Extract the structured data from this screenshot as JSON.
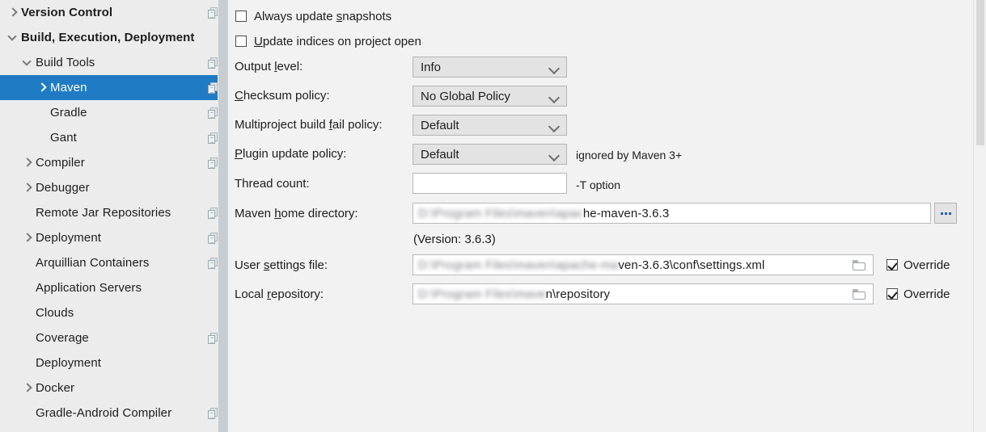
{
  "sidebar": {
    "items": [
      {
        "label": "Version Control",
        "indent": 0,
        "arrow": "collapsed",
        "bold": true,
        "copy": true,
        "selected": false
      },
      {
        "label": "Build, Execution, Deployment",
        "indent": 0,
        "arrow": "expanded",
        "bold": true,
        "copy": false,
        "selected": false
      },
      {
        "label": "Build Tools",
        "indent": 1,
        "arrow": "expanded",
        "bold": false,
        "copy": true,
        "selected": false
      },
      {
        "label": "Maven",
        "indent": 2,
        "arrow": "collapsed",
        "bold": false,
        "copy": true,
        "selected": true
      },
      {
        "label": "Gradle",
        "indent": 2,
        "arrow": "none",
        "bold": false,
        "copy": true,
        "selected": false
      },
      {
        "label": "Gant",
        "indent": 2,
        "arrow": "none",
        "bold": false,
        "copy": true,
        "selected": false
      },
      {
        "label": "Compiler",
        "indent": 1,
        "arrow": "collapsed",
        "bold": false,
        "copy": true,
        "selected": false
      },
      {
        "label": "Debugger",
        "indent": 1,
        "arrow": "collapsed",
        "bold": false,
        "copy": false,
        "selected": false
      },
      {
        "label": "Remote Jar Repositories",
        "indent": 1,
        "arrow": "none",
        "bold": false,
        "copy": true,
        "selected": false
      },
      {
        "label": "Deployment",
        "indent": 1,
        "arrow": "collapsed",
        "bold": false,
        "copy": true,
        "selected": false
      },
      {
        "label": "Arquillian Containers",
        "indent": 1,
        "arrow": "none",
        "bold": false,
        "copy": true,
        "selected": false
      },
      {
        "label": "Application Servers",
        "indent": 1,
        "arrow": "none",
        "bold": false,
        "copy": false,
        "selected": false
      },
      {
        "label": "Clouds",
        "indent": 1,
        "arrow": "none",
        "bold": false,
        "copy": false,
        "selected": false
      },
      {
        "label": "Coverage",
        "indent": 1,
        "arrow": "none",
        "bold": false,
        "copy": true,
        "selected": false
      },
      {
        "label": "Deployment",
        "indent": 1,
        "arrow": "none",
        "bold": false,
        "copy": false,
        "selected": false
      },
      {
        "label": "Docker",
        "indent": 1,
        "arrow": "collapsed",
        "bold": false,
        "copy": false,
        "selected": false
      },
      {
        "label": "Gradle-Android Compiler",
        "indent": 1,
        "arrow": "none",
        "bold": false,
        "copy": true,
        "selected": false
      }
    ]
  },
  "main": {
    "checkboxes": [
      {
        "label_pre": "Always update ",
        "label_mn": "s",
        "label_post": "napshots",
        "checked": false
      },
      {
        "label_pre": "",
        "label_mn": "U",
        "label_post": "pdate indices on project open",
        "checked": false
      }
    ],
    "output_level": {
      "label_pre": "Output ",
      "label_mn": "l",
      "label_post": "evel:",
      "value": "Info"
    },
    "checksum_policy": {
      "label_pre": "",
      "label_mn": "C",
      "label_post": "hecksum policy:",
      "value": "No Global Policy"
    },
    "multiproject_fail_policy": {
      "label_pre": "Multiproject build ",
      "label_mn": "f",
      "label_post": "ail policy:",
      "value": "Default"
    },
    "plugin_update_policy": {
      "label_pre": "",
      "label_mn": "P",
      "label_post": "lugin update policy:",
      "value": "Default",
      "hint": "ignored by Maven 3+"
    },
    "thread_count": {
      "label_pre": "Thread count:",
      "label_mn": "",
      "label_post": "",
      "value": "",
      "hint": "-T option"
    },
    "maven_home": {
      "label_pre": "Maven ",
      "label_mn": "h",
      "label_post": "ome directory:",
      "value_blurred": "D:\\Program Files\\maven\\apac",
      "value_clear": "he-maven-3.6.3",
      "version_note": "(Version: 3.6.3)",
      "browse_label": "..."
    },
    "user_settings_file": {
      "label_pre": "User ",
      "label_mn": "s",
      "label_post": "ettings file:",
      "value_blurred": "D:\\Program Files\\maven\\apache-ma",
      "value_clear": "ven-3.6.3\\conf\\settings.xml",
      "override_label": "Override",
      "override_checked": true
    },
    "local_repository": {
      "label_pre": "Local ",
      "label_mn": "r",
      "label_post": "epository:",
      "value_blurred": "D:\\Program Files\\mave",
      "value_clear": "n\\repository",
      "override_label": "Override",
      "override_checked": true
    }
  },
  "colors": {
    "selection": "#1f7cc4",
    "sidebar_bg": "#ececec",
    "panel_bg": "#f2f2f2"
  }
}
